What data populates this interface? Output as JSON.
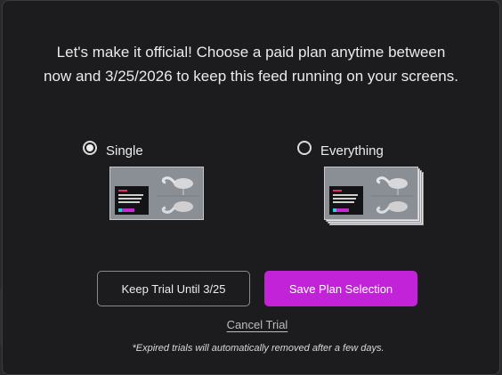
{
  "headline": {
    "line1": "Let's make it official! Choose a paid plan anytime between",
    "line2": "now and 3/25/2026 to keep this feed running on your screens."
  },
  "plans": [
    {
      "label": "Single",
      "selected": true,
      "preview_icon": "single-screen-preview"
    },
    {
      "label": "Everything",
      "selected": false,
      "preview_icon": "stacked-screens-preview"
    }
  ],
  "buttons": {
    "keep_trial": "Keep Trial Until 3/25",
    "save_plan": "Save Plan Selection",
    "cancel_trial": "Cancel Trial"
  },
  "note": "*Expired trials will automatically removed after a few days.",
  "colors": {
    "accent": "#c223d8",
    "modal_bg": "#1c1c1e",
    "page_bg": "#2a2a2c"
  }
}
